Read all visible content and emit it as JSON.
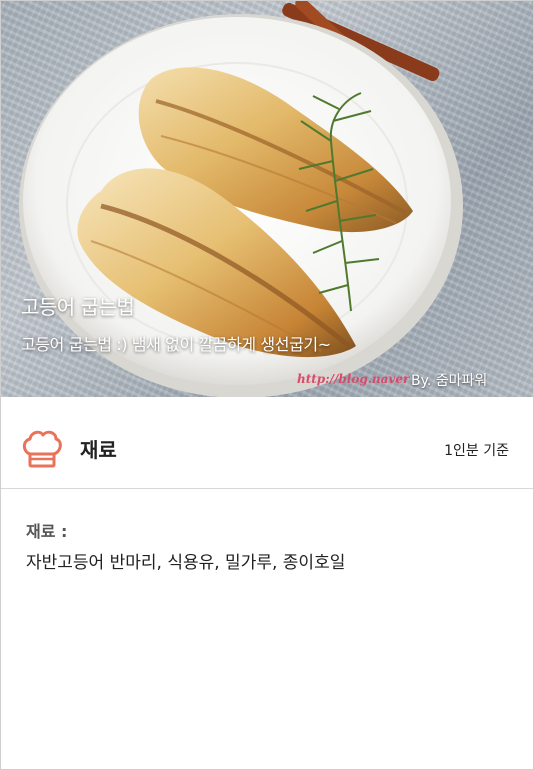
{
  "hero": {
    "title": "고등어 굽는법",
    "subtitle": "고등어 굽는법 :) 냄새 없이 깔끔하게 생선굽기~",
    "watermark": "http://blog.naver",
    "credit": "By. 줌마파워"
  },
  "ingredients": {
    "icon": "chef-hat-icon",
    "title": "재료",
    "serving": "1인분 기준",
    "label": "재료 :",
    "list": "자반고등어 반마리, 식용유, 밀가루, 종이호일"
  },
  "colors": {
    "accent": "#e8735a",
    "divider": "#d8d8d8"
  }
}
